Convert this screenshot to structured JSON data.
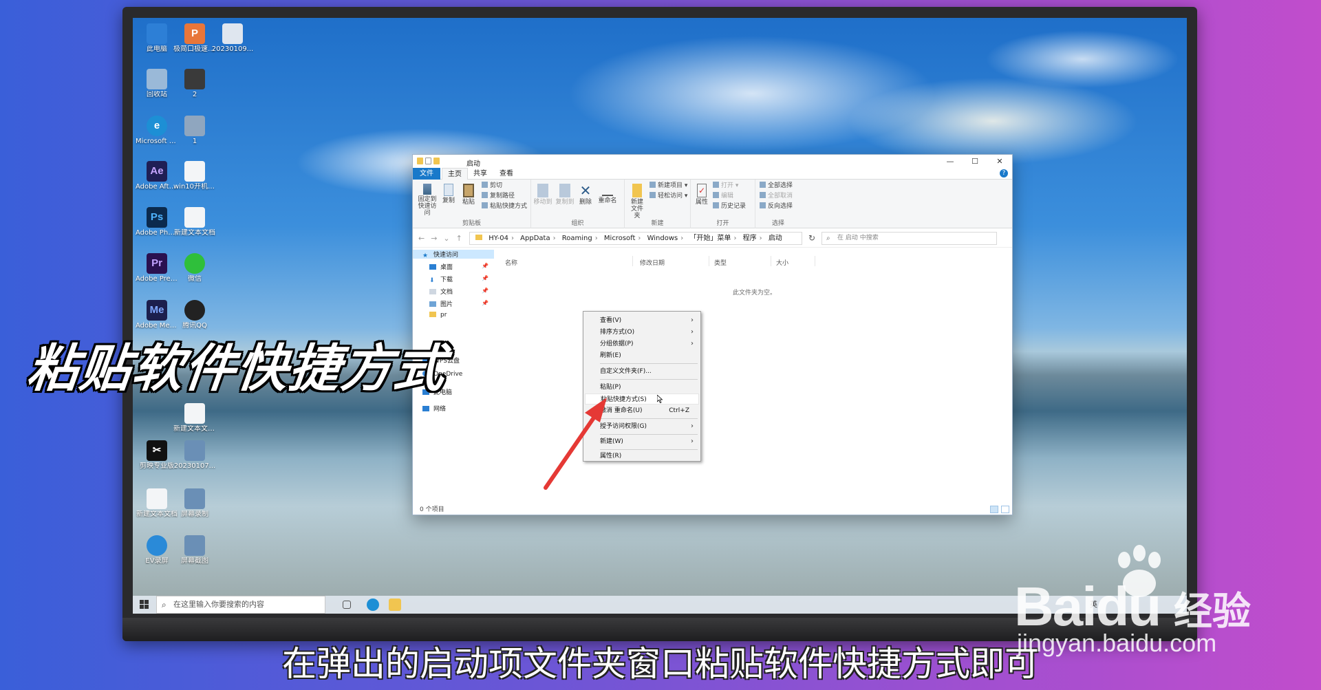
{
  "desktop": {
    "icons": [
      {
        "label": "此电脑",
        "color": "#2d7fd6",
        "glyph": ""
      },
      {
        "label": "极简口极速用PPT模板",
        "color": "#e8763a",
        "glyph": "P"
      },
      {
        "label": "20230109...",
        "color": "#dfe6ef",
        "glyph": ""
      },
      {
        "label": "回收站",
        "color": "#9ab9d8",
        "glyph": ""
      },
      {
        "label": "2",
        "color": "#3a3a3a",
        "glyph": ""
      },
      {
        "label": "Microsoft Edge",
        "color": "#1d8fd5",
        "glyph": "e"
      },
      {
        "label": "1",
        "color": "#8fa6bf",
        "glyph": ""
      },
      {
        "label": "Adobe After Effec...",
        "color": "#1f1f55",
        "glyph": "Ae"
      },
      {
        "label": "win10开机启动怎么设...",
        "color": "#f3f5f7",
        "glyph": ""
      },
      {
        "label": "Adobe Photosh...",
        "color": "#0b2a4d",
        "glyph": "Ps"
      },
      {
        "label": "新建文本文档",
        "color": "#f3f5f7",
        "glyph": ""
      },
      {
        "label": "Adobe Premie...",
        "color": "#2a1150",
        "glyph": "Pr"
      },
      {
        "label": "微信",
        "color": "#2fbf3b",
        "glyph": ""
      },
      {
        "label": "Adobe Media...",
        "color": "#1c1f4d",
        "glyph": "Me"
      },
      {
        "label": "腾讯QQ",
        "color": "#222",
        "glyph": ""
      },
      {
        "label": "新建文本文档(2)",
        "color": "#f3f5f7",
        "glyph": ""
      },
      {
        "label": "剪映专业版",
        "color": "#111",
        "glyph": "✂"
      },
      {
        "label": "20230107...",
        "color": "#6a8fb6",
        "glyph": ""
      },
      {
        "label": "新建文本文档",
        "color": "#f3f5f7",
        "glyph": ""
      },
      {
        "label": "屏幕录制",
        "color": "#6a8fb6",
        "glyph": ""
      },
      {
        "label": "EV录屏",
        "color": "#2a8ad8",
        "glyph": ""
      },
      {
        "label": "屏幕截图",
        "color": "#6a8fb6",
        "glyph": ""
      }
    ]
  },
  "taskbar": {
    "search_placeholder": "在这里输入你要搜索的内容",
    "ime": "英"
  },
  "explorer": {
    "title": "启动",
    "controls": {
      "minimize": "—",
      "maximize": "☐",
      "close": "✕"
    },
    "tabs": {
      "file": "文件",
      "home": "主页",
      "share": "共享",
      "view": "查看"
    },
    "ribbon": {
      "pin": "固定到快速访问",
      "copy": "复制",
      "paste": "粘贴",
      "cut": "剪切",
      "copy_path": "复制路径",
      "paste_shortcut": "粘贴快捷方式",
      "clipboard": "剪贴板",
      "move_to": "移动到",
      "copy_to": "复制到",
      "delete": "删除",
      "rename": "重命名",
      "organize": "组织",
      "new_folder": "新建文件夹",
      "new_item": "新建项目",
      "easy_access": "轻松访问",
      "new_group": "新建",
      "properties": "属性",
      "open": "打开",
      "edit": "编辑",
      "history": "历史记录",
      "open_group": "打开",
      "select_all": "全部选择",
      "select_none": "全部取消",
      "invert": "反向选择",
      "select_group": "选择"
    },
    "address": [
      "HY-04",
      "AppData",
      "Roaming",
      "Microsoft",
      "Windows",
      "「开始」菜单",
      "程序",
      "启动"
    ],
    "search_placeholder": "在 启动 中搜索",
    "nav": {
      "quick_access": "快速访问",
      "desktop": "桌面",
      "downloads": "下载",
      "documents": "文档",
      "pictures": "图片",
      "pr": "pr",
      "wps": "WPS云盘",
      "onedrive": "OneDrive",
      "this_pc": "此电脑",
      "network": "网络"
    },
    "columns": {
      "name": "名称",
      "modified": "修改日期",
      "type": "类型",
      "size": "大小"
    },
    "empty_message": "此文件夹为空。",
    "status": "0 个项目"
  },
  "context_menu": {
    "view": "查看(V)",
    "sort": "排序方式(O)",
    "group": "分组依据(P)",
    "refresh": "刷新(E)",
    "customize": "自定义文件夹(F)...",
    "paste": "粘贴(P)",
    "paste_shortcut": "粘贴快捷方式(S)",
    "undo_rename": "撤消 重命名(U)",
    "undo_shortcut": "Ctrl+Z",
    "give_access": "授予访问权限(G)",
    "new": "新建(W)",
    "properties": "属性(R)"
  },
  "overlay": {
    "headline": "粘贴软件快捷方式",
    "subtitle": "在弹出的启动项文件夹窗口粘贴软件快捷方式即可",
    "watermark_brand": "Baidu",
    "watermark_jy": "经验",
    "watermark_url": "jingyan.baidu.com",
    "arrow_color": "#e53935"
  }
}
